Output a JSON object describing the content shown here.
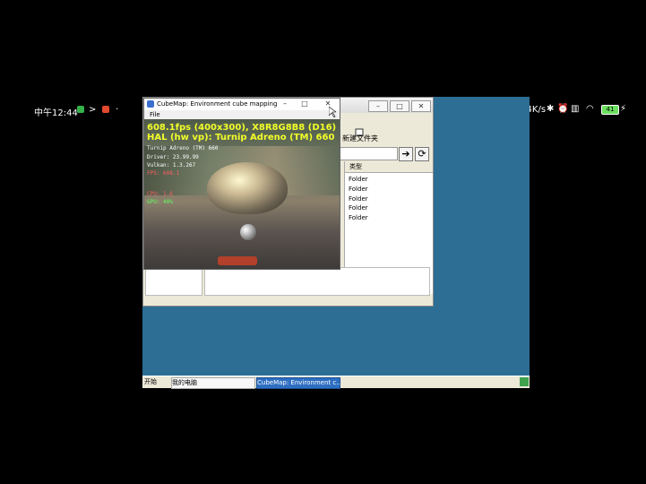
{
  "status_bar": {
    "time": "中午12:44",
    "net_speed": "0.4K/s",
    "battery": "41"
  },
  "explorer": {
    "toolbar_label": "新建文件夹",
    "list_header": "类型",
    "rows": [
      "Folder",
      "Folder",
      "Folder",
      "Folder",
      "Folder"
    ]
  },
  "cubemap": {
    "window_title": "CubeMap: Environment cube mapping",
    "menu_file": "File",
    "hud_line1": "608.1fps (400x300), X8R8G8B8 (D16)",
    "hud_line2": "HAL (hw vp): Turnip Adreno (TM) 660",
    "hud_small": [
      "Turnip Adreno (TM) 660",
      "Driver: 23.99.99",
      "Vulkan: 1.3.267",
      "FPS: 608.1"
    ],
    "hud_bottom": [
      "CPU: 1.6",
      "GPU: 40%"
    ]
  },
  "taskbar": {
    "start": "开始",
    "item1": "我的电脑",
    "item2": "CubeMap: Environment c..."
  },
  "colors": {
    "desktop": "#2c6e94",
    "hud": "#f2ff28",
    "taskbar_active": "#2e6fc2"
  }
}
